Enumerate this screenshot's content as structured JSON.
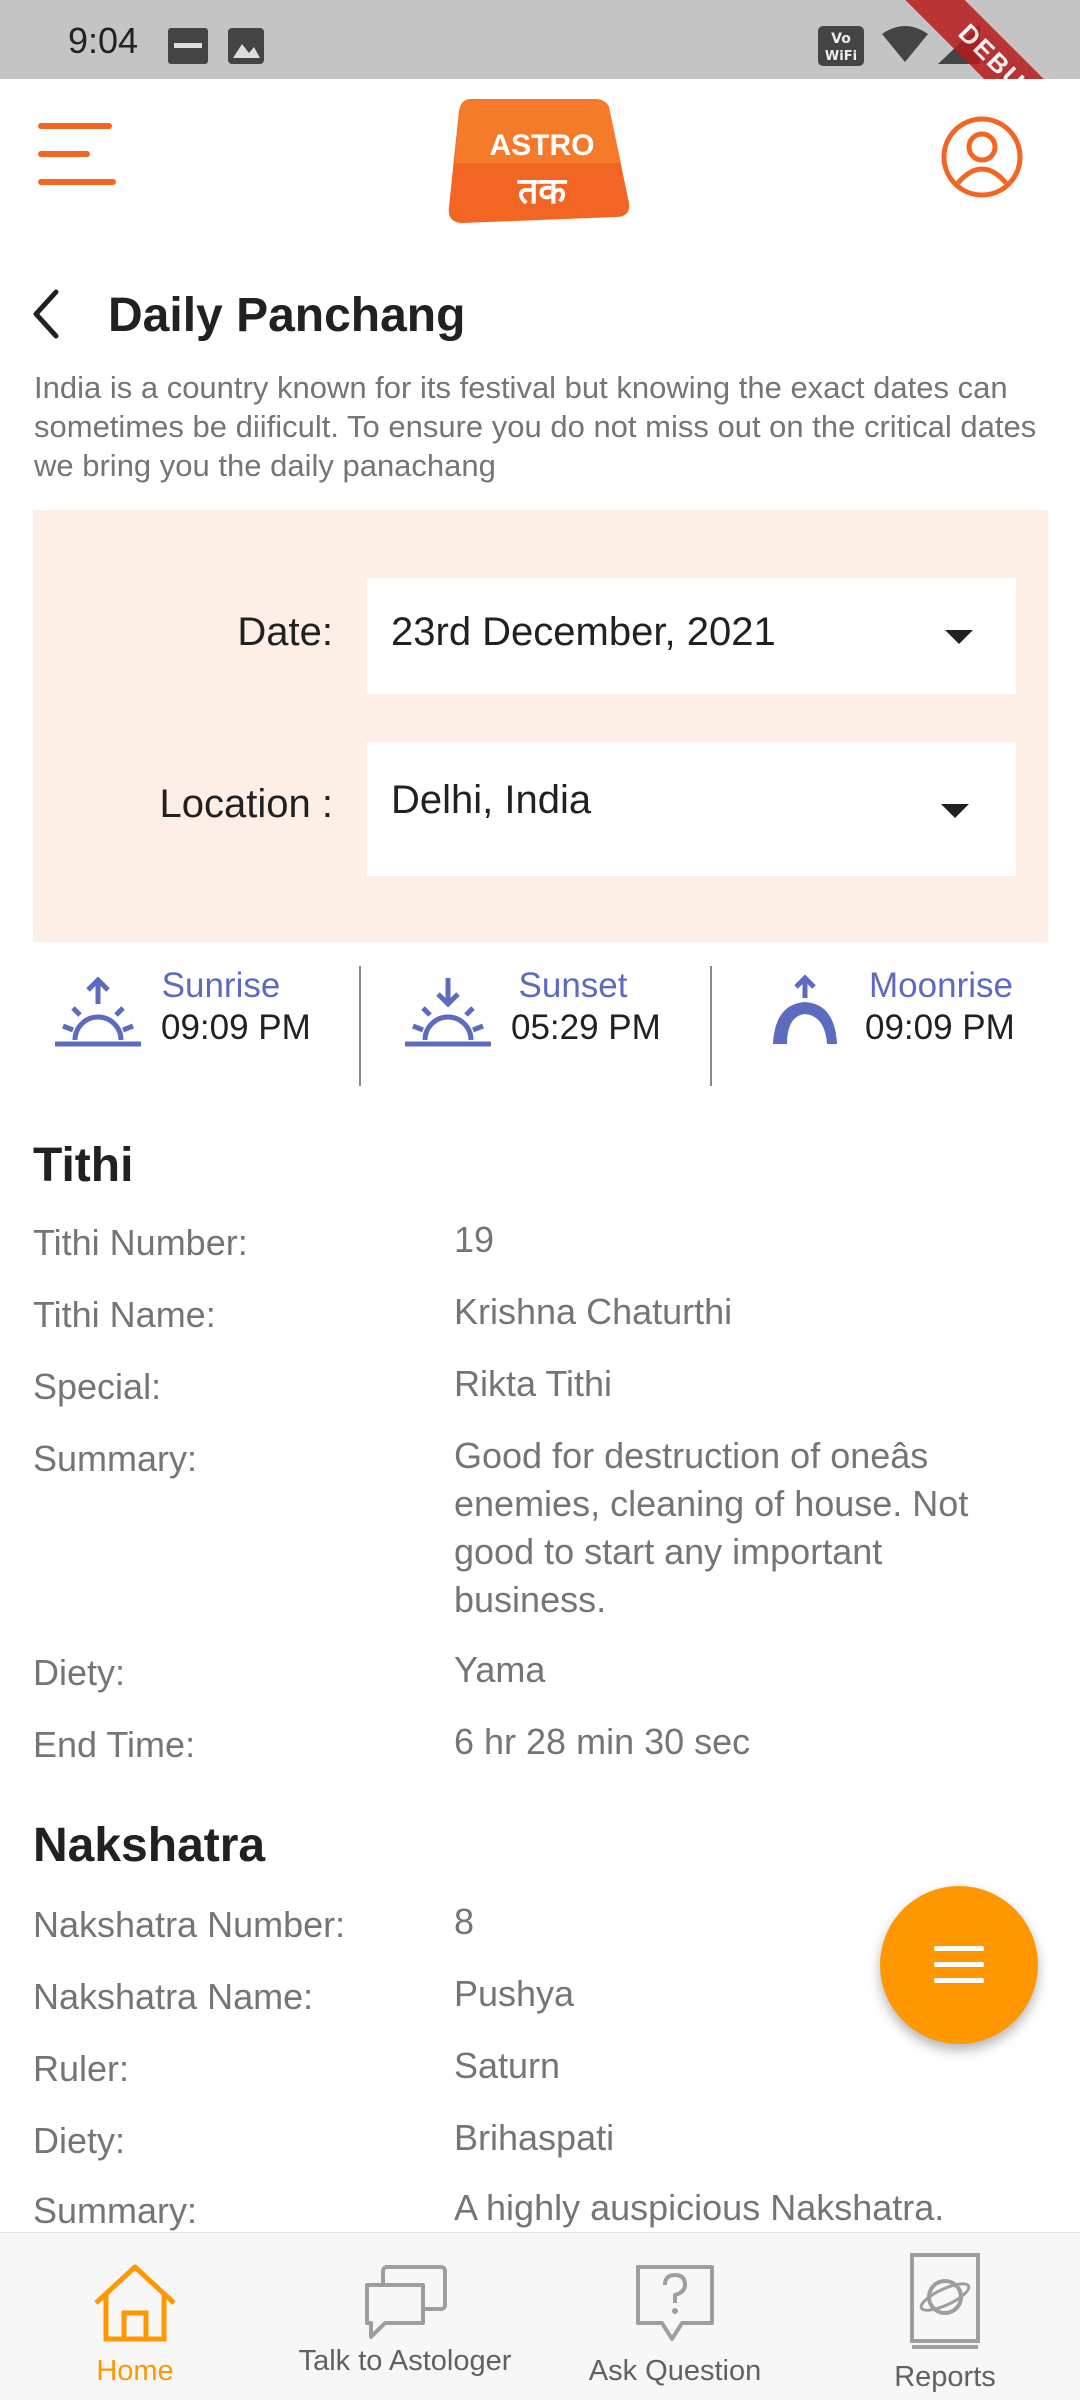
{
  "status_bar": {
    "time": "9:04",
    "debug_banner": "DEBUG"
  },
  "header": {
    "logo_line1": "ASTRO",
    "logo_line2": "तक"
  },
  "page": {
    "title": "Daily Panchang",
    "description": "India is a country known for its festival but knowing the exact dates can sometimes be diificult. To ensure you do not miss out on the critical dates we bring you the daily panachang"
  },
  "selectors": {
    "date_label": "Date:",
    "date_value": "23rd December, 2021",
    "location_label": "Location :",
    "location_value": "Delhi, India"
  },
  "astro_times": [
    {
      "label": "Sunrise",
      "value": "09:09 PM",
      "icon": "sunrise-icon"
    },
    {
      "label": "Sunset",
      "value": "05:29 PM",
      "icon": "sunset-icon"
    },
    {
      "label": "Moonrise",
      "value": "09:09 PM",
      "icon": "moonrise-icon"
    }
  ],
  "tithi": {
    "title": "Tithi",
    "rows": [
      {
        "label": "Tithi Number:",
        "value": "19"
      },
      {
        "label": "Tithi Name:",
        "value": "Krishna Chaturthi"
      },
      {
        "label": "Special:",
        "value": "Rikta Tithi"
      },
      {
        "label": "Summary:",
        "value": "Good for destruction of oneâs enemies, cleaning of house. Not good to start any important business."
      },
      {
        "label": "Diety:",
        "value": "Yama"
      },
      {
        "label": "End Time:",
        "value": "6 hr 28 min 30 sec"
      }
    ]
  },
  "nakshatra": {
    "title": "Nakshatra",
    "rows": [
      {
        "label": "Nakshatra Number:",
        "value": "8"
      },
      {
        "label": "Nakshatra Name:",
        "value": "Pushya"
      },
      {
        "label": "Ruler:",
        "value": "Saturn"
      },
      {
        "label": "Diety:",
        "value": "Brihaspati"
      },
      {
        "label": "Summary:",
        "value": "A highly auspicious Nakshatra."
      }
    ]
  },
  "bottom_nav": [
    {
      "label": "Home",
      "icon": "home-icon",
      "active": true
    },
    {
      "label": "Talk to Astologer",
      "icon": "chat-icon",
      "active": false
    },
    {
      "label": "Ask Question",
      "icon": "question-icon",
      "active": false
    },
    {
      "label": "Reports",
      "icon": "reports-icon",
      "active": false
    }
  ],
  "colors": {
    "brand_orange": "#f26522",
    "fab_orange": "#ff9800",
    "panel_bg": "#fdeee6",
    "astro_blue": "#5c6bc0",
    "nav_active": "#ff9800"
  }
}
